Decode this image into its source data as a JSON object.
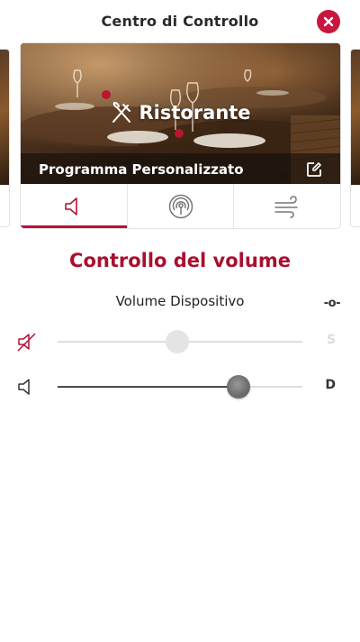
{
  "header": {
    "title": "Centro di Controllo",
    "close_icon": "close-icon"
  },
  "program": {
    "name": "Ristorante",
    "icon": "fork-knife-icon",
    "subtitle": "Programma Personalizzato",
    "edit_icon": "edit-icon"
  },
  "tabs": [
    {
      "icon": "speaker-icon",
      "active": true
    },
    {
      "icon": "hearing-signal-icon",
      "active": false
    },
    {
      "icon": "wind-icon",
      "active": false
    }
  ],
  "volume": {
    "title": "Controllo del volume",
    "device_label": "Volume Dispositivo",
    "balance_mark": "-o-",
    "sliders": [
      {
        "icon": "speaker-muted-icon",
        "side": "S",
        "level": 0.49,
        "enabled": false
      },
      {
        "icon": "speaker-icon",
        "side": "D",
        "level": 0.74,
        "enabled": true
      }
    ]
  },
  "colors": {
    "accent": "#c8163d",
    "title": "#a8102f",
    "muted_icon": "#b2133a"
  }
}
